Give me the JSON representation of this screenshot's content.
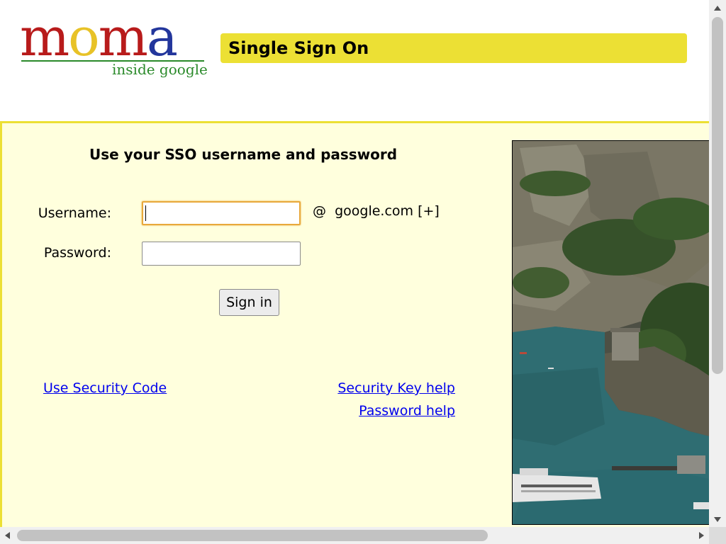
{
  "header": {
    "logo": {
      "letters": [
        "m",
        "o",
        "m",
        "a"
      ],
      "letter_colors": [
        "#b81b1b",
        "#e8c227",
        "#b81b1b",
        "#23369c"
      ],
      "tagline": "inside google"
    },
    "title": "Single Sign On"
  },
  "login_form": {
    "heading": "Use your SSO username and password",
    "username_label": "Username:",
    "username_value": "",
    "domain_suffix": "@  google.com [+]",
    "password_label": "Password:",
    "password_value": "",
    "submit_label": "Sign in"
  },
  "links": {
    "security_code": "Use Security Code",
    "security_key_help": "Security Key help",
    "password_help": "Password help"
  },
  "photo": {
    "subject": "coastal-cliff-harbor-photo"
  },
  "colors": {
    "title_bar": "#ece034",
    "panel_background": "#ffffdd",
    "panel_border": "#ece034",
    "focus_ring": "#e8a93c",
    "link": "#0000ee"
  },
  "scrollbars": {
    "vertical": "visible",
    "horizontal": "visible"
  }
}
